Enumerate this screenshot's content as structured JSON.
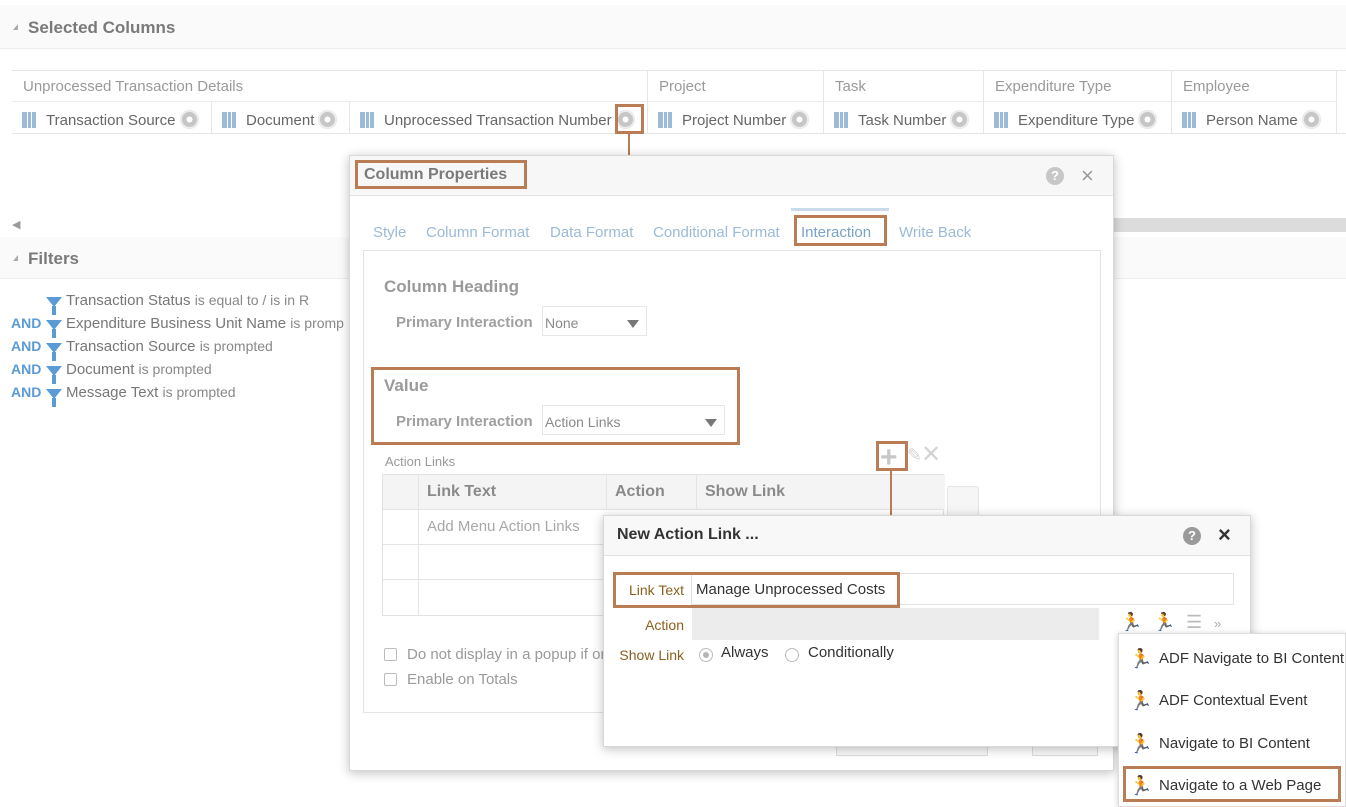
{
  "selected_columns": {
    "title": "Selected Columns",
    "groups": [
      {
        "label": "Unprocessed Transaction Details"
      },
      {
        "label": "Project"
      },
      {
        "label": "Task"
      },
      {
        "label": "Expenditure Type"
      },
      {
        "label": "Employee"
      }
    ],
    "columns": [
      {
        "label": "Transaction Source"
      },
      {
        "label": "Document"
      },
      {
        "label": "Unprocessed Transaction Number"
      },
      {
        "label": "Project Number"
      },
      {
        "label": "Task Number"
      },
      {
        "label": "Expenditure Type"
      },
      {
        "label": "Person Name"
      }
    ]
  },
  "filters": {
    "title": "Filters",
    "items": [
      {
        "conj": "",
        "name": "Transaction Status",
        "cond": "is equal to / is in  R"
      },
      {
        "conj": "AND",
        "name": "Expenditure Business Unit Name",
        "cond": "is promp"
      },
      {
        "conj": "AND",
        "name": "Transaction Source",
        "cond": "is prompted"
      },
      {
        "conj": "AND",
        "name": "Document",
        "cond": "is prompted"
      },
      {
        "conj": "AND",
        "name": "Message Text",
        "cond": "is prompted"
      }
    ]
  },
  "column_properties": {
    "title": "Column Properties",
    "help": "?",
    "close": "×",
    "tabs": [
      {
        "label": "Style"
      },
      {
        "label": "Column Format"
      },
      {
        "label": "Data Format"
      },
      {
        "label": "Conditional Format"
      },
      {
        "label": "Interaction"
      },
      {
        "label": "Write Back"
      }
    ],
    "column_heading": {
      "title": "Column Heading",
      "primary_label": "Primary Interaction",
      "primary_value": "None"
    },
    "value": {
      "title": "Value",
      "primary_label": "Primary Interaction",
      "primary_value": "Action Links"
    },
    "action_links": {
      "label": "Action Links",
      "headers": {
        "link_text": "Link Text",
        "action": "Action",
        "show_link": "Show Link"
      },
      "placeholder": "Add Menu Action Links"
    },
    "checkboxes": {
      "no_popup": "Do not display in a popup if or",
      "totals": "Enable on Totals"
    }
  },
  "new_action_link": {
    "title": "New Action Link ...",
    "help": "?",
    "close": "×",
    "link_text_label": "Link Text",
    "link_text_value": "Manage Unprocessed Costs",
    "action_label": "Action",
    "show_link_label": "Show Link",
    "show_always": "Always",
    "show_conditionally": "Conditionally"
  },
  "action_menu": {
    "items": [
      {
        "label": "ADF Navigate to BI Content"
      },
      {
        "label": "ADF Contextual Event"
      },
      {
        "label": "Navigate to BI Content"
      },
      {
        "label": "Navigate to a Web Page"
      }
    ]
  },
  "colors": {
    "highlight": "#b97c55",
    "accent_blue": "#5b9bd5",
    "menu_icon_green": "#3cae4c"
  }
}
